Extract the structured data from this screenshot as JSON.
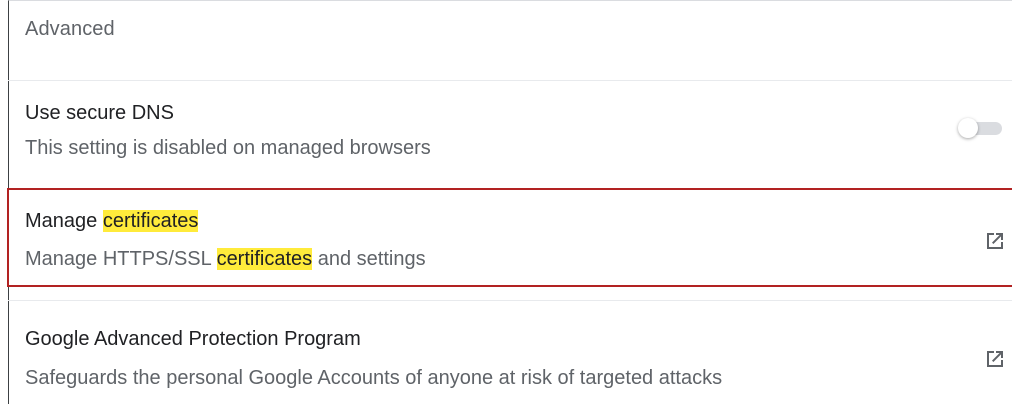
{
  "section": {
    "title": "Advanced"
  },
  "rows": [
    {
      "title": "Use secure DNS",
      "subtitle": "This setting is disabled on managed browsers",
      "control": "toggle",
      "toggle_state": "off-disabled"
    },
    {
      "title_prefix": "Manage ",
      "title_highlight": "certificates",
      "subtitle_prefix": "Manage HTTPS/SSL ",
      "subtitle_highlight": "certificates",
      "subtitle_suffix": " and settings",
      "control": "external-link-icon"
    },
    {
      "title": "Google Advanced Protection Program",
      "subtitle": "Safeguards the personal Google Accounts of anyone at risk of targeted attacks",
      "control": "external-link-icon"
    }
  ],
  "colors": {
    "highlight": "#ffeb3b",
    "selection_border": "#b22222",
    "primary_text": "#202124",
    "secondary_text": "#5f6368"
  }
}
